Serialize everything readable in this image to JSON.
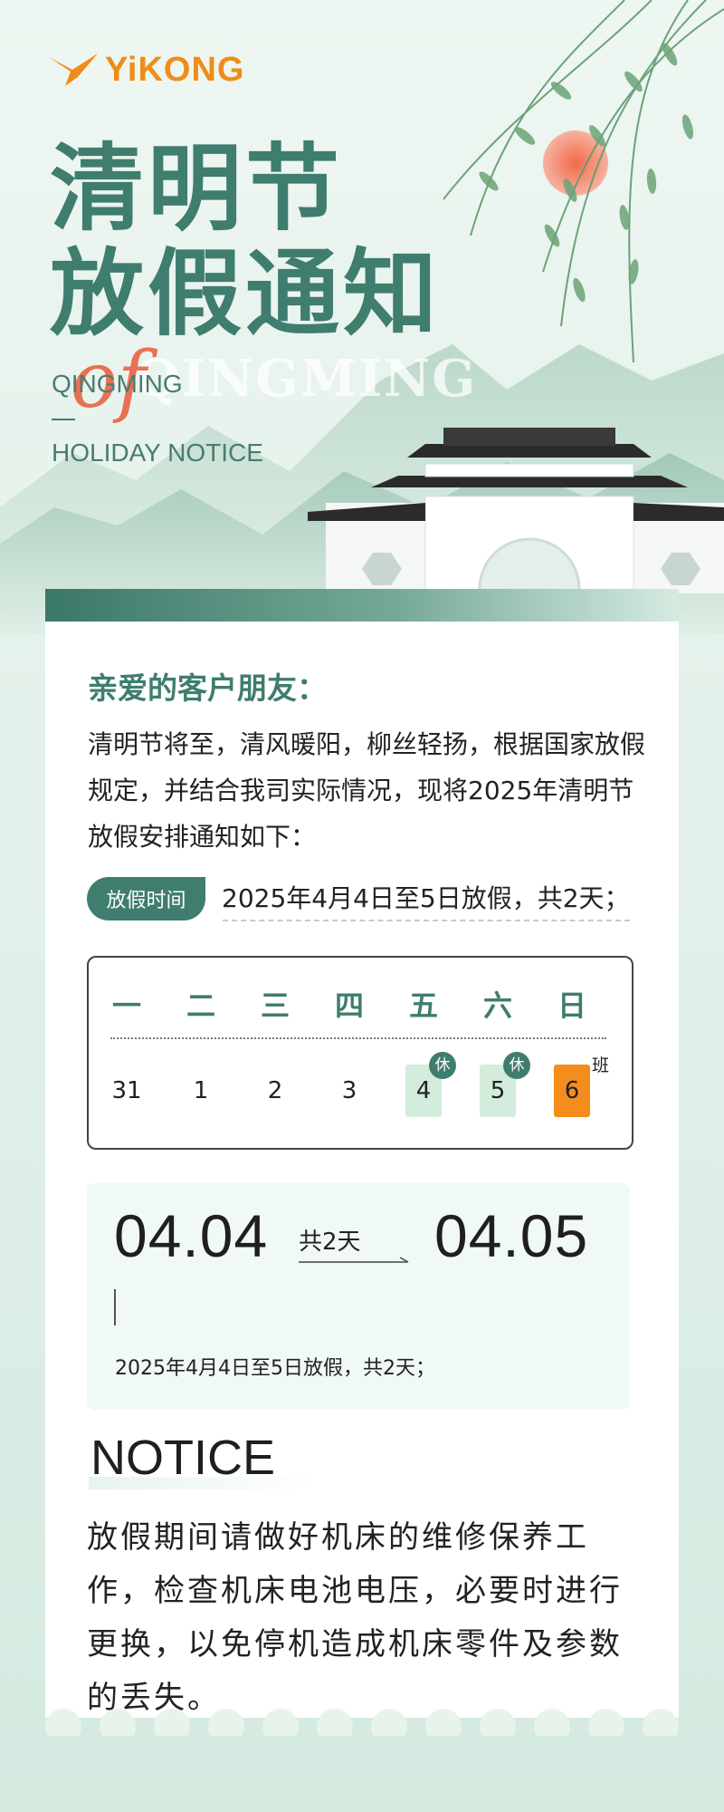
{
  "brand": {
    "name": "YiKONG",
    "color": "#f08c18"
  },
  "hero": {
    "title_line1": "清明节",
    "title_line2": "放假通知",
    "sub_line1": "QINGMING",
    "sub_line2": "HOLIDAY NOTICE",
    "script_word": "of",
    "ghost_text": "QINGMING"
  },
  "letter": {
    "greeting": "亲爱的客户朋友：",
    "paragraph": "清明节将至，清风暖阳，柳丝轻扬，根据国家放假规定，并结合我司实际情况，现将2025年清明节放假安排通知如下：",
    "tag": "放假时间",
    "tag_text": "2025年4月4日至5日放假，共2天；"
  },
  "calendar": {
    "weekdays": [
      "一",
      "二",
      "三",
      "四",
      "五",
      "六",
      "日"
    ],
    "days": [
      "31",
      "1",
      "2",
      "3",
      "4",
      "5",
      "6"
    ],
    "rest_badge": "休",
    "work_badge": "班",
    "colors": {
      "rest": "#d3ecdc",
      "work": "#f58d1c",
      "accent": "#3f7d6e"
    }
  },
  "range": {
    "start": "04.04",
    "end": "04.05",
    "duration": "共2天",
    "note": "2025年4月4日至5日放假，共2天；"
  },
  "notice": {
    "heading": "NOTICE",
    "text": "放假期间请做好机床的维修保养工作，检查机床电池电压，必要时进行更换，以免停机造成机床零件及参数的丢失。"
  }
}
